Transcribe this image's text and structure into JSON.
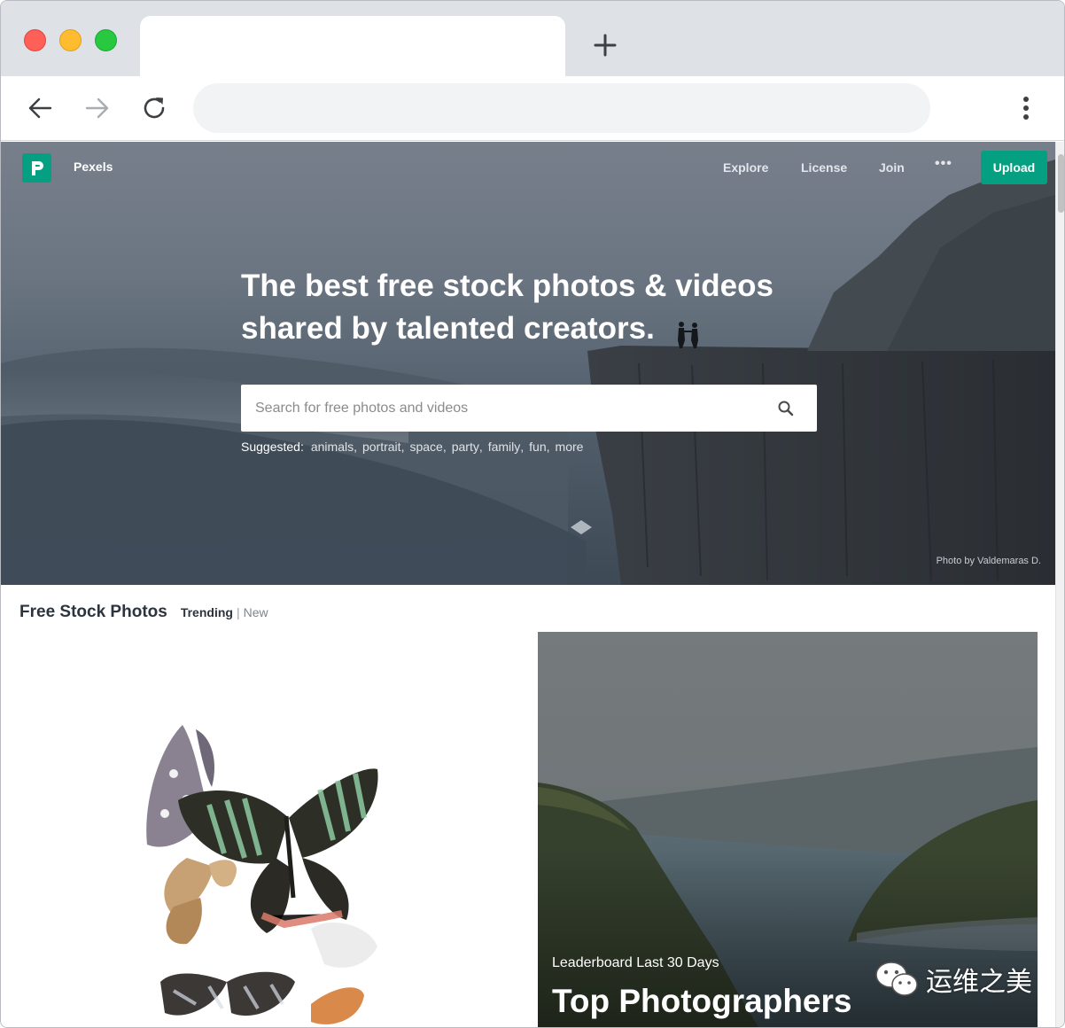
{
  "browser": {
    "tab_title": "",
    "address": ""
  },
  "site": {
    "logo_text": "Pexels",
    "nav": {
      "explore": "Explore",
      "license": "License",
      "join": "Join",
      "more": "•••",
      "upload": "Upload"
    },
    "hero": {
      "title_line1": "The best free stock photos & videos",
      "title_line2": "shared by talented creators.",
      "search_placeholder": "Search for free photos and videos",
      "suggested_label": "Suggested:",
      "suggestions": [
        "animals",
        "portrait",
        "space",
        "party",
        "family",
        "fun",
        "more"
      ],
      "photo_credit": "Photo by Valdemaras D."
    },
    "section": {
      "title": "Free Stock Photos",
      "trending": "Trending",
      "separator": "|",
      "new": "New"
    },
    "leaderboard": {
      "subtitle": "Leaderboard Last 30 Days",
      "title": "Top Photographers"
    },
    "watermark": "运维之美"
  },
  "colors": {
    "brand": "#05a081",
    "tabstrip": "#dee1e6",
    "omnibox": "#f1f3f4"
  }
}
